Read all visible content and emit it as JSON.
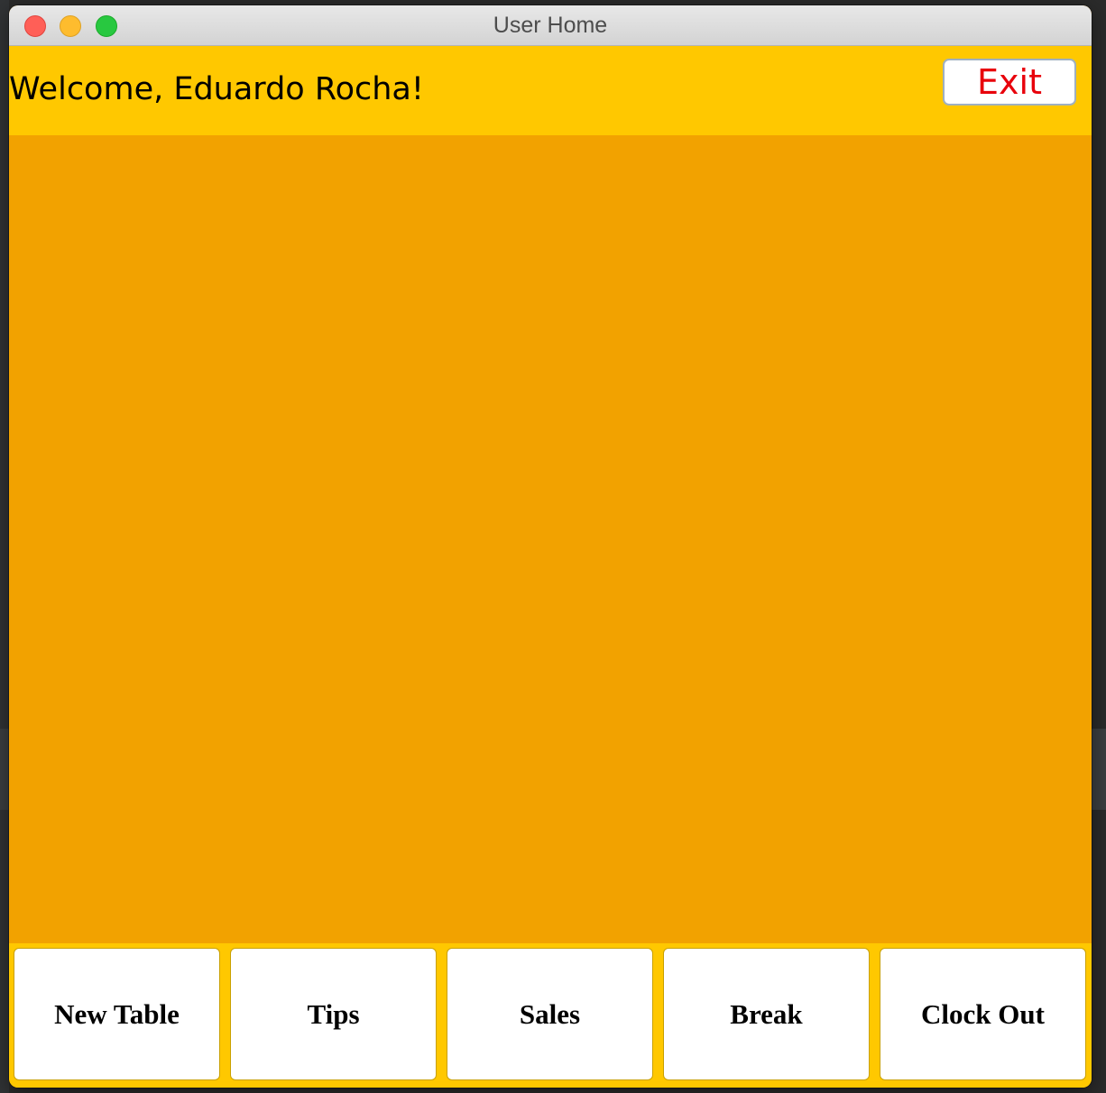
{
  "window": {
    "title": "User Home"
  },
  "header": {
    "welcome_text": "Welcome, Eduardo Rocha!",
    "exit_label": "Exit"
  },
  "actions": [
    {
      "label": "New Table"
    },
    {
      "label": "Tips"
    },
    {
      "label": "Sales"
    },
    {
      "label": "Break"
    },
    {
      "label": "Clock Out"
    }
  ],
  "colors": {
    "header_bg": "#ffc800",
    "content_bg": "#f2a200",
    "exit_text": "#e8000b"
  }
}
